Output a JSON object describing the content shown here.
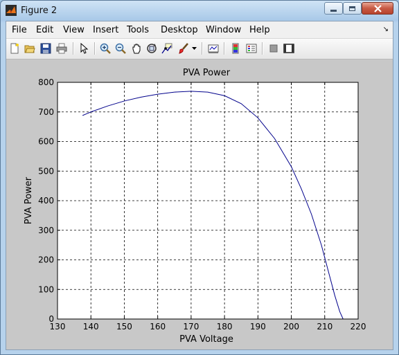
{
  "window": {
    "title": "Figure 2"
  },
  "menu": {
    "items": [
      "File",
      "Edit",
      "View",
      "Insert",
      "Tools",
      "Desktop",
      "Window",
      "Help"
    ],
    "dock_glyph": "↘"
  },
  "toolbar": {
    "icons": [
      "new-figure-icon",
      "open-file-icon",
      "save-icon",
      "print-icon",
      "edit-plot-icon",
      "zoom-in-icon",
      "zoom-out-icon",
      "pan-icon",
      "rotate-3d-icon",
      "data-cursor-icon",
      "brush-icon",
      "link-plot-icon",
      "insert-colorbar-icon",
      "insert-legend-icon",
      "hide-plot-tools-icon",
      "show-plot-tools-icon"
    ]
  },
  "chart_data": {
    "type": "line",
    "title": "PVA Power",
    "xlabel": "PVA Voltage",
    "ylabel": "PVA Power",
    "xlim": [
      130,
      220
    ],
    "ylim": [
      0,
      800
    ],
    "xticks": [
      130,
      140,
      150,
      160,
      170,
      180,
      190,
      200,
      210,
      220
    ],
    "yticks": [
      0,
      100,
      200,
      300,
      400,
      500,
      600,
      700,
      800
    ],
    "grid": true,
    "grid_style": "dashed",
    "line_color": "#00008b",
    "series": [
      {
        "x": [
          137.5,
          140,
          145,
          150,
          155,
          160,
          165,
          170,
          175,
          180,
          185,
          190,
          195,
          200,
          203,
          206,
          209,
          211,
          213,
          214.5,
          215.5
        ],
        "y": [
          688,
          700,
          720,
          737,
          750,
          760,
          767,
          770,
          767,
          755,
          728,
          680,
          610,
          515,
          440,
          355,
          250,
          165,
          80,
          25,
          0
        ]
      }
    ]
  }
}
